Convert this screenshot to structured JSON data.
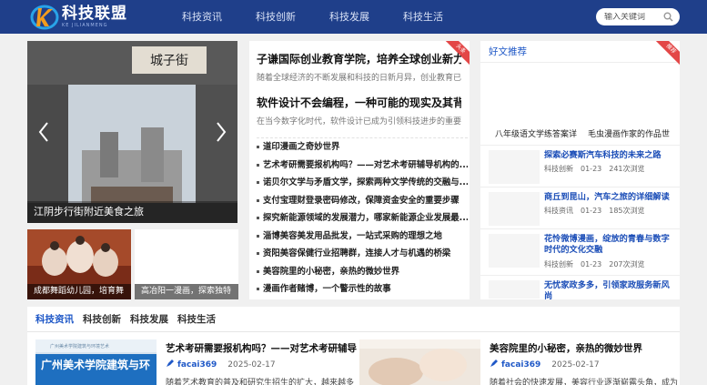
{
  "brand": {
    "title": "科技联盟",
    "subtitle": "KE JILIANMENG"
  },
  "nav": [
    {
      "label": "科技资讯"
    },
    {
      "label": "科技创新"
    },
    {
      "label": "科技发展"
    },
    {
      "label": "科技生活"
    }
  ],
  "search": {
    "placeholder": "输入关键词"
  },
  "slider": {
    "caption": "江阴步行街附近美食之旅",
    "sign_text": "城子街"
  },
  "thumbs": [
    {
      "caption": "成都舞蹈幼儿园，培育舞"
    },
    {
      "caption": "高冶阳一漫画，探索独特"
    }
  ],
  "news": {
    "badge": "头条",
    "featured": [
      {
        "title": "子谦国际创业教育学院，培养全球创业新力量",
        "desc": "随着全球经济的不断发展和科技的日新月异，创业教育已..."
      },
      {
        "title": "软件设计不会编程，一种可能的现实及其背后",
        "desc": "在当今数字化时代，软件设计已成为引领科技进步的重要..."
      }
    ],
    "items": [
      "道印漫画之奇妙世界",
      "艺术考研需要报机构吗？——对艺术考研辅导机构的...",
      "诺贝尔文学与矛盾文学，探索两种文学传统的交融与...",
      "支付宝理财登录密码修改，保障资金安全的重要步骤",
      "探究新能源领域的发展潜力，哪家新能源企业发展最...",
      "淄博美容美发用品批发，一站式采购的理想之地",
      "资阳美容保健行业招聘群，连接人才与机遇的桥梁",
      "美容院里的小秘密，亲热的微妙世界",
      "漫画作者赌博，一个警示性的故事"
    ]
  },
  "recommend": {
    "title": "好文推荐",
    "badge": "推荐",
    "captions": [
      "八年级语文学练答案详",
      "毛虫漫画作家的作品世"
    ],
    "items": [
      {
        "title": "探索必赛斯汽车科技的未来之路",
        "category": "科技创新",
        "date": "01-23",
        "views": "241次浏览"
      },
      {
        "title": "商丘到昆山，汽车之旅的详细解读",
        "category": "科技资讯",
        "date": "01-23",
        "views": "185次浏览"
      },
      {
        "title": "花怜微博漫画，绽放的青春与数字时代的文化交融",
        "category": "科技创新",
        "date": "01-23",
        "views": "207次浏览"
      },
      {
        "title": "无忧家政多多，引领家政服务新风尚",
        "category": "",
        "date": "",
        "views": ""
      }
    ]
  },
  "tabs": [
    {
      "label": "科技资讯"
    },
    {
      "label": "科技创新"
    },
    {
      "label": "科技发展"
    },
    {
      "label": "科技生活"
    }
  ],
  "articles": [
    {
      "title": "艺术考研需要报机构吗？——对艺术考研辅导",
      "author": "facai369",
      "date": "2025-02-17",
      "desc": "随着艺术教育的普及和研究生招生的扩大，越来越多",
      "img_text": "广州美术学院建筑与环",
      "img_small": "广州美术学院建筑与环境艺术"
    },
    {
      "title": "美容院里的小秘密，亲热的微妙世界",
      "author": "facai369",
      "date": "2025-02-17",
      "desc": "随着社会的快速发展，美容行业逐渐崭露头角，成为"
    }
  ],
  "colors": {
    "header": "#1f3f8a",
    "accent": "#1f58c7",
    "badge": "#e34747"
  }
}
